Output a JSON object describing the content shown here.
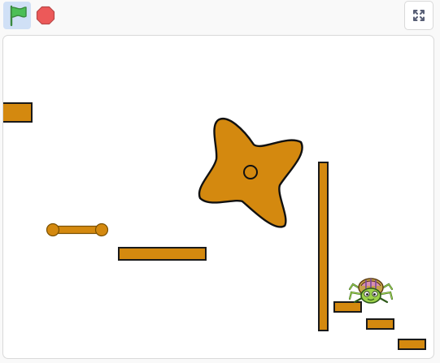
{
  "toolbar": {
    "green_flag_icon": "green-flag-icon",
    "stop_icon": "stop-sign-icon",
    "fullscreen_icon": "fullscreen-icon"
  },
  "stage": {
    "sprites": [
      "ledge-platform",
      "spinning-star-obstacle",
      "bone-platform",
      "flat-platform",
      "vertical-wall",
      "spider-character",
      "step-platform-1",
      "step-platform-2",
      "step-platform-3"
    ]
  },
  "colors": {
    "platform": "#d4890f",
    "outline": "#1a1a1a",
    "flag": "#4cbf56",
    "stop": "#ec5959",
    "spider_body": "#9bd04a",
    "spider_shell": "#c8a24a",
    "flag_button_bg": "#d0e0f6"
  }
}
